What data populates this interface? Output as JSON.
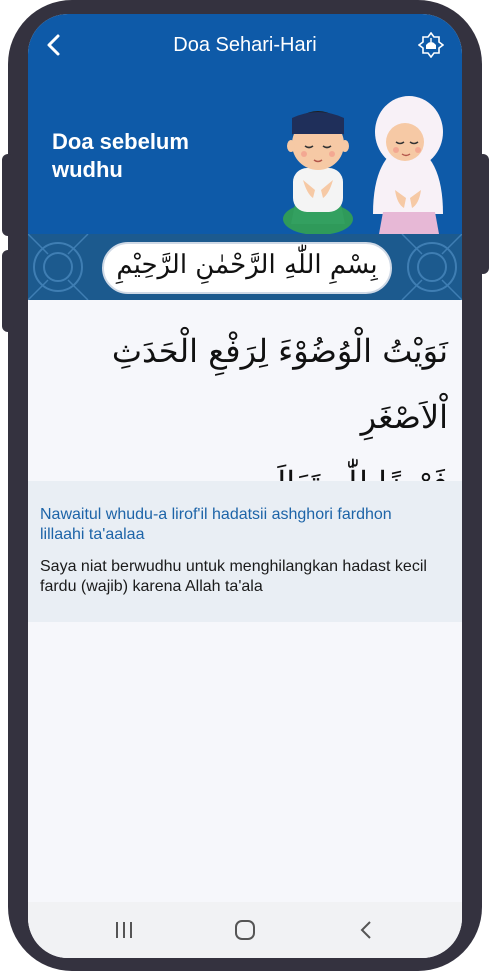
{
  "header": {
    "title": "Doa Sehari-Hari",
    "back_icon": "back-arrow-icon",
    "action_icon": "mosque-icon",
    "color": "#0e5aa8"
  },
  "doa": {
    "title_line1": "Doa sebelum",
    "title_line2": "wudhu",
    "bismillah": "بِسْمِ اللّٰهِ الرَّحْمٰنِ الرَّحِيْمِ",
    "arabic_line1": "نَوَيْتُ الْوُضُوْءَ لِرَفْعِ الْحَدَثِ اْلاَصْغَرِ",
    "arabic_line2": "فَرْضًا لِلّٰهِ تَعَالَى",
    "latin": "Nawaitul whudu-a lirof'il hadatsii ashghori fardhon lillaahi ta'aalaa",
    "translation": "Saya niat berwudhu untuk menghilangkan hadast kecil fardu (wajib) karena Allah ta'ala",
    "latin_color": "#1d64a8"
  },
  "navbar": {
    "recents_icon": "recents-icon",
    "home_icon": "home-icon",
    "back_icon": "back-chevron-icon"
  }
}
